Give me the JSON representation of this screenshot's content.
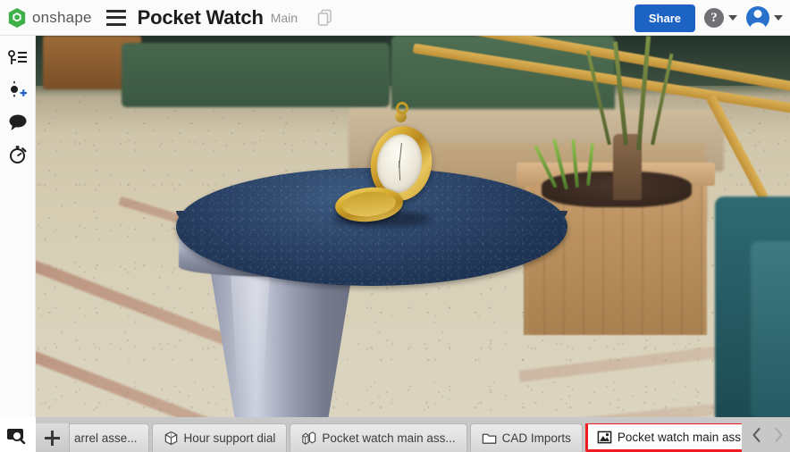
{
  "header": {
    "brand": "onshape",
    "brand_logo_icon": "onshape-logo-icon",
    "menu_icon": "hamburger-menu-icon",
    "document_title": "Pocket Watch",
    "workspace_name": "Main",
    "copy_icon": "copy-documents-icon",
    "share_label": "Share",
    "help_glyph": "?",
    "help_icon": "help-circle-icon",
    "account_icon": "user-avatar-icon",
    "share_color": "#1d63c4"
  },
  "sidebar": {
    "items": [
      {
        "name": "instances-panel",
        "icon": "version-graph-icon",
        "label": "Instances"
      },
      {
        "name": "create-version",
        "icon": "create-version-plus-icon",
        "label": "Create version"
      },
      {
        "name": "comments-panel",
        "icon": "comment-bubble-icon",
        "label": "Comments"
      },
      {
        "name": "history-panel",
        "icon": "stopwatch-history-icon",
        "label": "History"
      }
    ]
  },
  "viewport": {
    "content_type": "rendered-image",
    "description": "Rendered gold pocket watch standing open on a blue felt pedestal table in a photographic lobby scene",
    "scene": {
      "subject": "gold pocket watch",
      "table_surface": "blue felt round tabletop",
      "pedestal": "brushed metal conical pedestal",
      "background": "lobby interior with potted plant, wooden planter, green seating and terrazzo floor"
    }
  },
  "tabbar": {
    "search_icon": "tab-search-icon",
    "add_icon": "add-tab-plus-icon",
    "add_label": "+",
    "tabs": [
      {
        "label": "arrel asse...",
        "icon": "assembly-icon",
        "active": false,
        "clipped": true
      },
      {
        "label": "Hour support dial",
        "icon": "part-studio-icon",
        "active": false,
        "clipped": false
      },
      {
        "label": "Pocket watch main ass...",
        "icon": "assembly-icon",
        "active": false,
        "clipped": false
      },
      {
        "label": "CAD Imports",
        "icon": "folder-icon",
        "active": false,
        "clipped": false
      },
      {
        "label": "Pocket watch main ass...",
        "icon": "image-picture-icon",
        "active": true,
        "clipped": false
      }
    ],
    "prev_icon": "chevron-left-icon",
    "next_icon": "chevron-right-icon",
    "highlight_color": "#ee1c22"
  }
}
